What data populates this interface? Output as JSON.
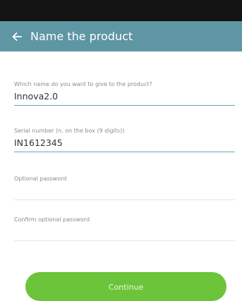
{
  "header": {
    "back_icon": "arrow-left-icon",
    "title": "Name the product"
  },
  "form": {
    "product_name": {
      "label": "Which name do you want to give to the product?",
      "value": "Innova2.0"
    },
    "serial_number": {
      "label": "Serial number (n. on the box (9 digits))",
      "value": "IN1612345"
    },
    "optional_password": {
      "label": "Optional password",
      "value": ""
    },
    "confirm_password": {
      "label": "Confirm optional password",
      "value": ""
    }
  },
  "actions": {
    "continue_label": "Continue"
  },
  "colors": {
    "status_bar": "#141414",
    "app_bar": "#5e96a4",
    "accent_underline": "#6fa3b3",
    "button": "#6cc43a"
  }
}
